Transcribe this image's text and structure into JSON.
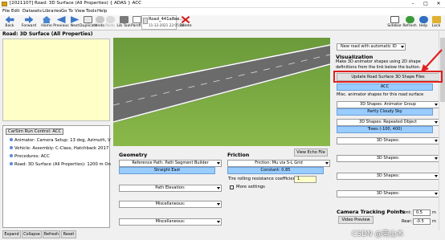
{
  "window": {
    "title": "[2021107] Road: 3D Surface (All Properties) { ADAS } ACC",
    "min_glyph": "–",
    "max_glyph": "□",
    "close_glyph": "✕"
  },
  "menu": [
    "File",
    "Edit",
    "Datasets",
    "Libraries",
    "Go To",
    "View",
    "Tools",
    "Help"
  ],
  "toolbar": {
    "back": "Back",
    "forward": "Forward",
    "home": "Home",
    "previous": "Previous",
    "next": "Next",
    "duplicate": "Duplicate",
    "undo": "Undo",
    "redo": "Redo",
    "lib_tool": "Lib Tool",
    "parsfile": "Parsfile",
    "delete": "Delete",
    "sidebar": "Sidebar",
    "refresh": "Refresh",
    "help": "Help",
    "lock": "Lock"
  },
  "dataset": {
    "name": "Road_441a8ee...",
    "date": "11-12-2021 22:05:18"
  },
  "page_heading": "Road: 3D Surface (All Properties)",
  "tree": {
    "root": "CarSim Run Control: ACC",
    "items": [
      "Animator: Camera Setup: 13 deg, Azimuth, V",
      "Vehicle: Assembly: C-Class, Hatchback 2017",
      "Procedures: ACC",
      "Road: 3D Surface (All Properties): 1200 m On"
    ]
  },
  "bottom_buttons": {
    "expand": "Expand",
    "collapse": "Collapse",
    "refresh": "Refresh",
    "reset": "Reset"
  },
  "geometry": {
    "title": "Geometry",
    "reference_path_label": "Reference Path: Path Segment Builder",
    "reference_path_value": "Straight East",
    "path_elevation": "Path Elevation:",
    "misc1": "Miscellaneous:",
    "misc2": "Miscellaneous:"
  },
  "friction": {
    "title": "Friction",
    "view_echo": "View Echo File",
    "mu_label": "Friction: Mu via S-L Grid",
    "mu_value": "Constant: 0.85",
    "rolling_label": "Tire rolling resistance coefficient:",
    "rolling_value": "1",
    "more_settings": "More settings"
  },
  "right": {
    "new_road": "New road with automatic ID",
    "vis_title": "Visualization",
    "vis_desc": "Make 3D animator shapes using 2D shape definitions from the link below the button.",
    "update_btn": "Update Road Surface 3D Shape Files",
    "acc_value": "ACC",
    "misc_desc": "Misc. animator shapes for this road surface",
    "shape1_label": "3D Shapes: Animator Group",
    "shape1_value": "Partly Cloudy Sky",
    "shape2_label": "3D Shapes: Repeated Object",
    "shape2_value": "Trees (-100, 400)",
    "shape3": "3D Shapes:",
    "shape4": "3D Shapes:",
    "shape5": "3D Shapes:",
    "shape6": "3D Shapes:",
    "camera_title": "Camera Tracking Points",
    "video_preview": "Video Preview",
    "front_label": "Front:",
    "front_value": "0.5",
    "rear_label": "Rear:",
    "rear_value": "-0.5",
    "unit": "m"
  },
  "watermark": "CSDN @南山木"
}
